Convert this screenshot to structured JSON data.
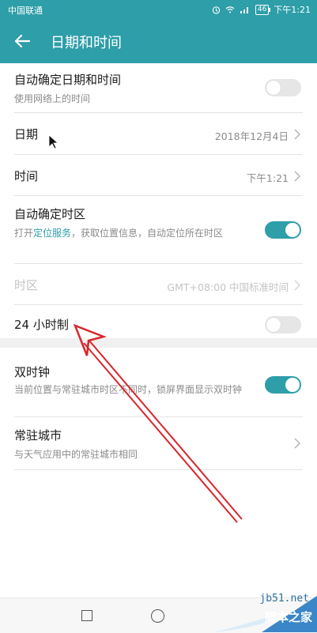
{
  "status_bar": {
    "carrier": "中国联通",
    "battery": "46",
    "time": "下午1:21"
  },
  "app_bar": {
    "title": "日期和时间",
    "back_icon": "arrow-left-icon"
  },
  "settings": [
    {
      "id": "auto-datetime",
      "label": "自动确定日期和时间",
      "sub": "使用网络上的时间",
      "control": "toggle",
      "on": false
    },
    {
      "id": "date",
      "label": "日期",
      "value": "2018年12月4日",
      "control": "chevron"
    },
    {
      "id": "time",
      "label": "时间",
      "value": "下午1:21",
      "control": "chevron"
    },
    {
      "id": "auto-timezone",
      "label": "自动确定时区",
      "sub_prefix": "打开",
      "sub_link": "定位服务",
      "sub_suffix": "，获取位置信息，自动定位所在时区",
      "control": "toggle",
      "on": true
    },
    {
      "id": "timezone",
      "label": "时区",
      "value": "GMT+08:00 中国标准时间",
      "control": "chevron",
      "disabled": true
    },
    {
      "id": "24-hour",
      "label": "24 小时制",
      "control": "toggle",
      "on": false
    },
    {
      "id": "dual-clock",
      "label": "双时钟",
      "sub": "当前位置与常驻城市时区不同时，锁屏界面显示双时钟",
      "control": "toggle",
      "on": true
    },
    {
      "id": "home-city",
      "label": "常驻城市",
      "sub": "与天气应用中的常驻城市相同",
      "control": "chevron"
    }
  ],
  "watermark": {
    "url": "jb51.net",
    "name": "脚本之家"
  },
  "colors": {
    "accent": "#2e9ea9",
    "annotation_arrow": "#d9262b"
  }
}
